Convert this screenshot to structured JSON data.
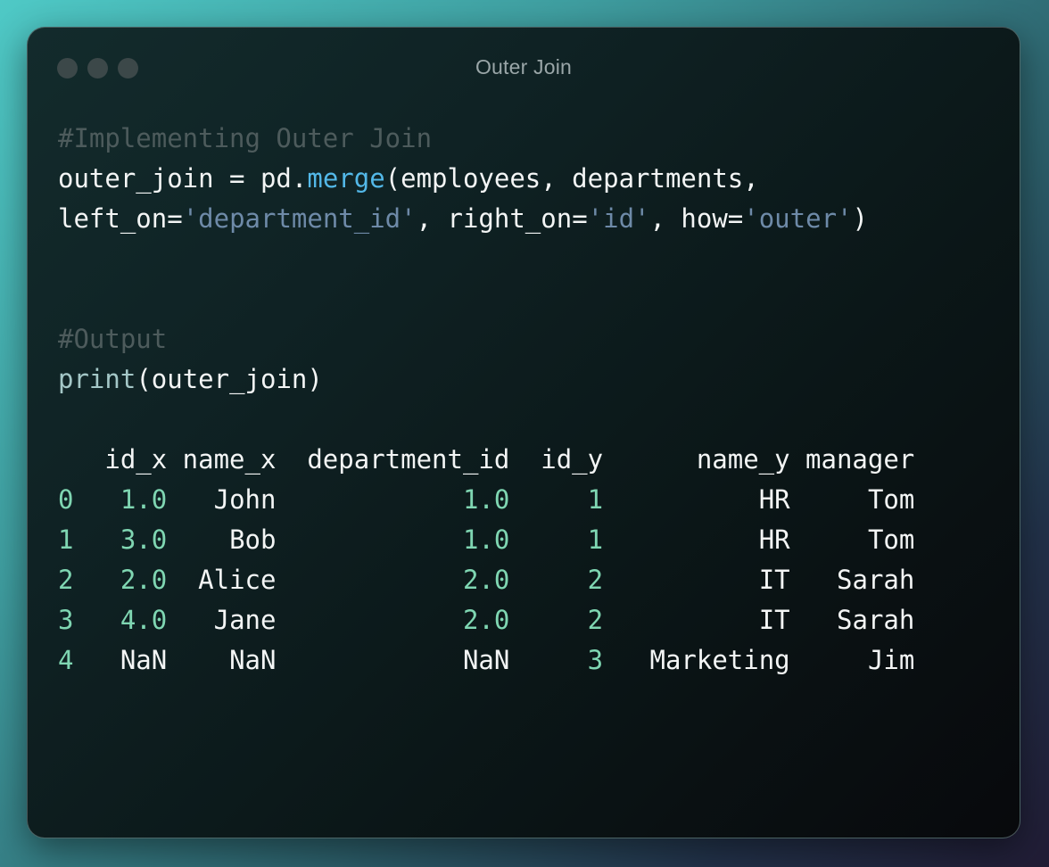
{
  "window": {
    "title": "Outer Join"
  },
  "colors": {
    "background_gradient": [
      "#4fc9c6",
      "#2c5f6a",
      "#211c35"
    ],
    "window_bg": "#0d1c1e",
    "comment": "#4d5b5c",
    "function": "#53b8e8",
    "string": "#6e8aa8",
    "builtin": "#a4c7c7",
    "number": "#7fd6b2",
    "text": "#f3f5f5",
    "title": "#9aa6a8",
    "traffic_light": "#3c4849"
  },
  "code": {
    "comment_impl": "#Implementing Outer Join",
    "line1": {
      "t1": "outer_join = pd.",
      "fn": "merge",
      "t2": "(employees, departments,"
    },
    "line2": {
      "t1": "left_on=",
      "s1": "'department_id'",
      "t2": ", right_on=",
      "s2": "'id'",
      "t3": ", how=",
      "s3": "'outer'",
      "t4": ")"
    },
    "comment_output": "#Output",
    "print_line": {
      "builtin": "print",
      "rest": "(outer_join)"
    }
  },
  "output": {
    "header": "   id_x name_x  department_id  id_y      name_y manager",
    "rows": [
      {
        "idx": "0",
        "c1": "   1.0",
        "c2": "   John",
        "c3": "            1.0",
        "c4": "     1",
        "c5": "          HR",
        "c6": "     Tom"
      },
      {
        "idx": "1",
        "c1": "   3.0",
        "c2": "    Bob",
        "c3": "            1.0",
        "c4": "     1",
        "c5": "          HR",
        "c6": "     Tom"
      },
      {
        "idx": "2",
        "c1": "   2.0",
        "c2": "  Alice",
        "c3": "            2.0",
        "c4": "     2",
        "c5": "          IT",
        "c6": "   Sarah"
      },
      {
        "idx": "3",
        "c1": "   4.0",
        "c2": "   Jane",
        "c3": "            2.0",
        "c4": "     2",
        "c5": "          IT",
        "c6": "   Sarah"
      },
      {
        "idx": "4",
        "c1": "   NaN",
        "c2": "    NaN",
        "c3": "            NaN",
        "c4": "     3",
        "c5": "   Marketing",
        "c6": "     Jim"
      }
    ]
  }
}
